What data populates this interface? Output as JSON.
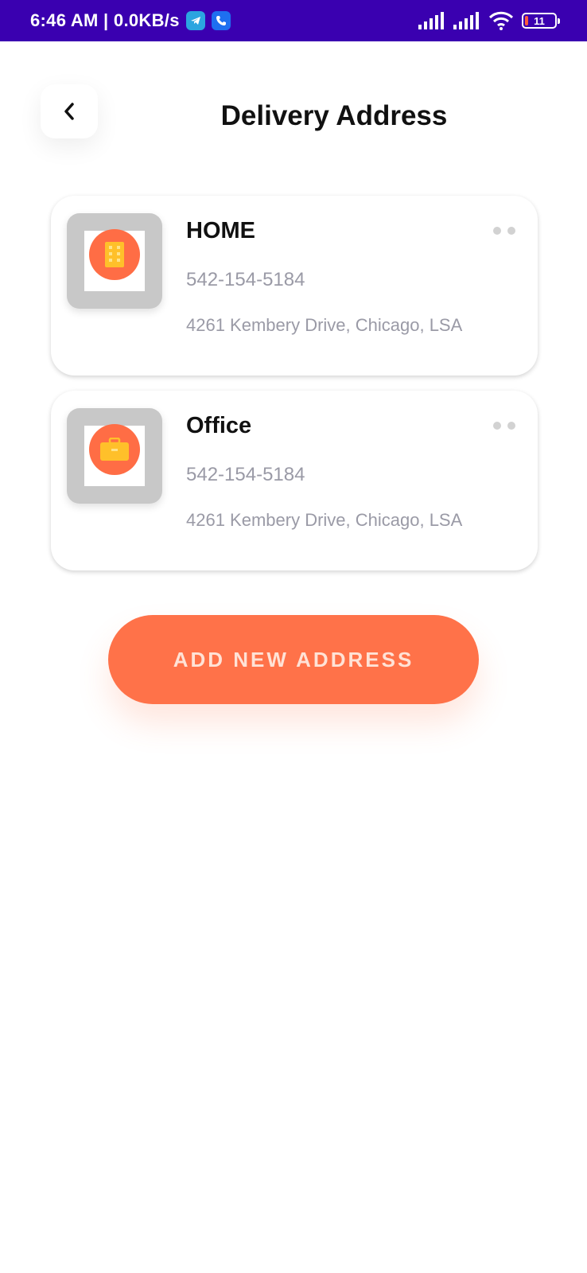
{
  "status_bar": {
    "time": "6:46 AM | 0.0KB/s",
    "app_icons": [
      "telegram-icon",
      "phone-app-icon"
    ],
    "battery_level": "11"
  },
  "header": {
    "title": "Delivery Address",
    "back_icon": "chevron-left-icon"
  },
  "addresses": [
    {
      "name": "HOME",
      "phone": "542-154-5184",
      "address": "4261 Kembery Drive, Chicago, LSA",
      "icon": "building-icon"
    },
    {
      "name": "Office",
      "phone": "542-154-5184",
      "address": "4261 Kembery Drive, Chicago, LSA",
      "icon": "briefcase-icon"
    }
  ],
  "actions": {
    "add_label": "ADD NEW ADDRESS"
  },
  "colors": {
    "status_bar": "#3a00b0",
    "accent": "#ff7249",
    "icon_yellow": "#ffc02a"
  }
}
